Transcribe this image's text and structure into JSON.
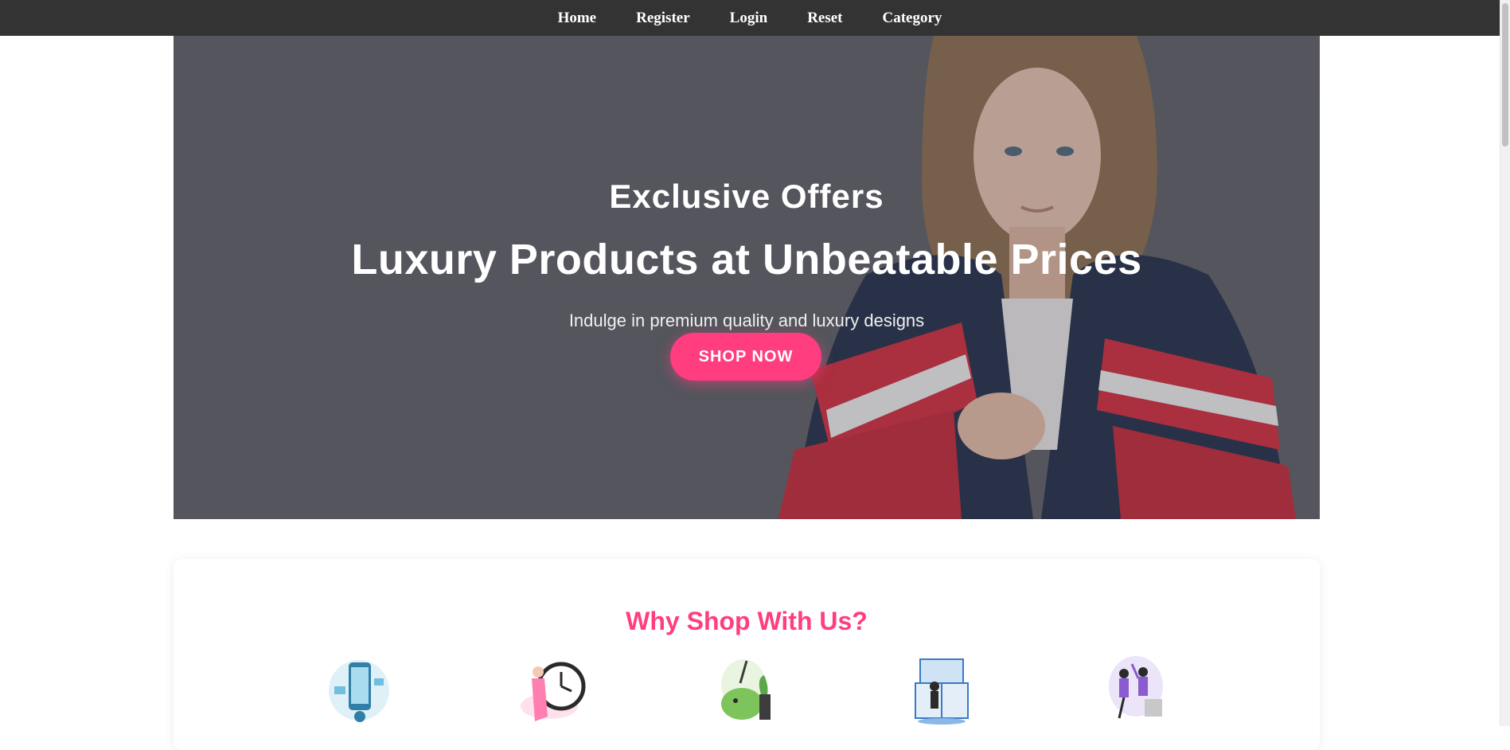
{
  "nav": {
    "items": [
      {
        "label": "Home"
      },
      {
        "label": "Register"
      },
      {
        "label": "Login"
      },
      {
        "label": "Reset"
      },
      {
        "label": "Category"
      }
    ]
  },
  "hero": {
    "eyebrow": "Exclusive Offers",
    "title": "Luxury Products at Unbeatable Prices",
    "subtitle": "Indulge in premium quality and luxury designs",
    "cta_label": "SHOP NOW",
    "accent_color": "#ff3d7f"
  },
  "why": {
    "title": "Why Shop With Us?",
    "icons": [
      {
        "name": "mobile-shopping-illustration-icon"
      },
      {
        "name": "fast-delivery-clock-illustration-icon"
      },
      {
        "name": "savings-piggy-bank-illustration-icon"
      },
      {
        "name": "online-store-illustration-icon"
      },
      {
        "name": "team-high-five-illustration-icon"
      }
    ]
  }
}
